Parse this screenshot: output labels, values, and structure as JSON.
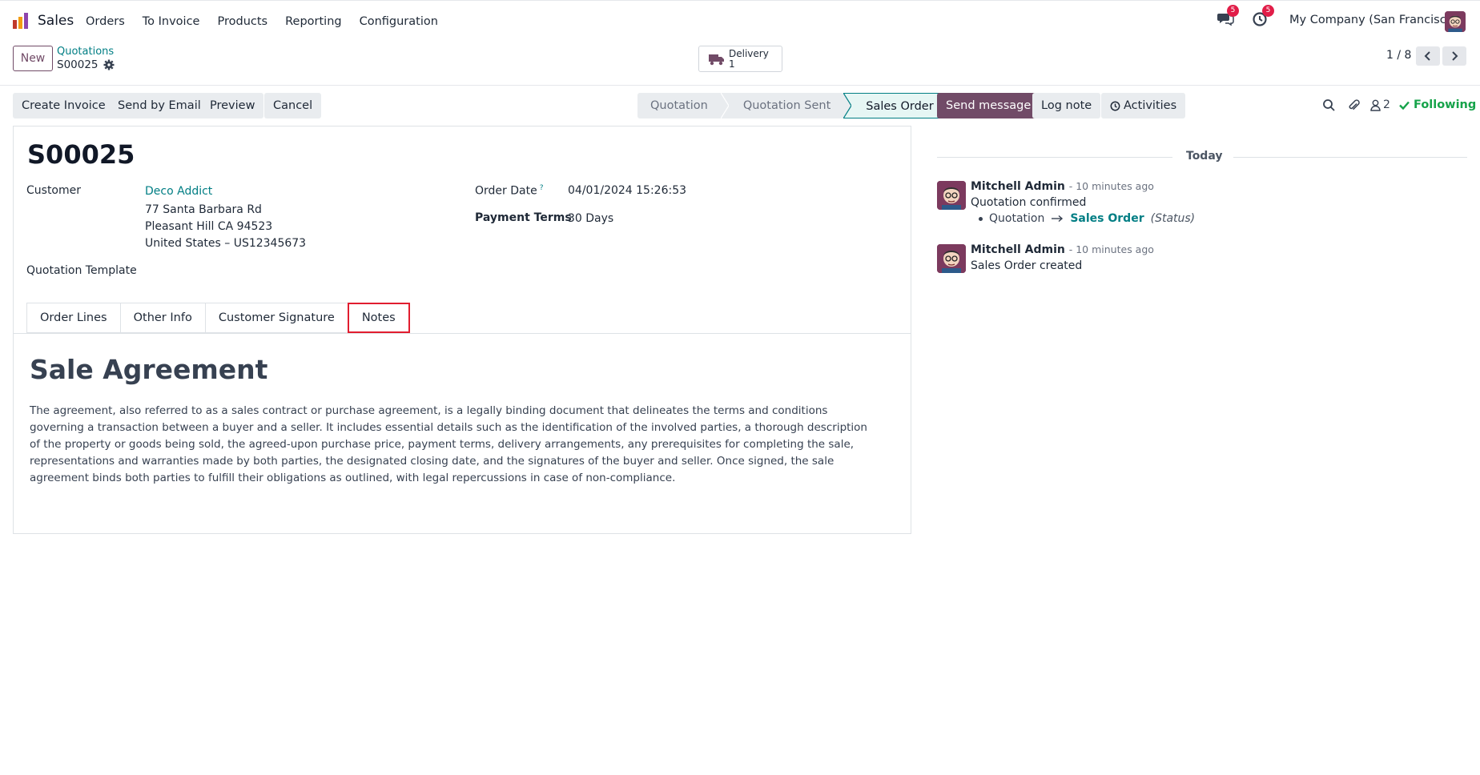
{
  "navbar": {
    "app_name": "Sales",
    "menu": [
      "Orders",
      "To Invoice",
      "Products",
      "Reporting",
      "Configuration"
    ],
    "messages_badge": "5",
    "activities_badge": "5",
    "company": "My Company (San Francisco)"
  },
  "control_panel": {
    "new_label": "New",
    "breadcrumb_parent": "Quotations",
    "breadcrumb_current": "S00025",
    "delivery_label": "Delivery",
    "delivery_count": "1",
    "pager": "1 / 8"
  },
  "actions": {
    "create_invoice": "Create Invoice",
    "send_by_email": "Send by Email",
    "preview": "Preview",
    "cancel": "Cancel"
  },
  "status_bar": {
    "stages": [
      "Quotation",
      "Quotation Sent",
      "Sales Order"
    ],
    "active": "Sales Order"
  },
  "form": {
    "name": "S00025",
    "customer_label": "Customer",
    "customer_name": "Deco Addict",
    "address_line1": "77 Santa Barbara Rd",
    "address_line2": "Pleasant Hill CA 94523",
    "address_line3": "United States – US12345673",
    "order_date_label": "Order Date",
    "order_date_help": "?",
    "order_date": "04/01/2024 15:26:53",
    "payment_terms_label": "Payment Terms",
    "payment_terms": "30 Days",
    "quotation_template_label": "Quotation Template",
    "tabs": [
      "Order Lines",
      "Other Info",
      "Customer Signature",
      "Notes"
    ],
    "active_tab": "Notes",
    "notes_title": "Sale Agreement",
    "notes_body": "The agreement, also referred to as a sales contract or purchase agreement, is a legally binding document that delineates the terms and conditions governing a transaction between a buyer and a seller. It includes essential details such as the identification of the involved parties, a thorough description of the property or goods being sold, the agreed-upon purchase price, payment terms, delivery arrangements, any prerequisites for completing the sale, representations and warranties made by both parties, the designated closing date, and the signatures of the buyer and seller. Once signed, the sale agreement binds both parties to fulfill their obligations as outlined, with legal repercussions in case of non-compliance."
  },
  "chatter": {
    "send_message": "Send message",
    "log_note": "Log note",
    "activities": "Activities",
    "followers_count": "2",
    "following": "Following",
    "date_separator": "Today",
    "messages": [
      {
        "author": "Mitchell Admin",
        "time": "- 10 minutes ago",
        "body": "Quotation confirmed",
        "tracking_old": "Quotation",
        "tracking_new": "Sales Order",
        "tracking_field": "(Status)"
      },
      {
        "author": "Mitchell Admin",
        "time": "- 10 minutes ago",
        "body": "Sales Order created"
      }
    ]
  },
  "colors": {
    "brand": "#714b67",
    "link": "#017e84",
    "following": "#16a34a",
    "badge": "#e11d48",
    "highlight_border": "#e11d2f"
  },
  "icons": [
    "app-logo-icon",
    "chat-icon",
    "clock-icon",
    "gear-icon",
    "truck-icon",
    "chevron-left-icon",
    "chevron-right-icon",
    "search-icon",
    "paperclip-icon",
    "user-icon",
    "check-icon",
    "clock-small-icon",
    "arrow-right-icon"
  ]
}
